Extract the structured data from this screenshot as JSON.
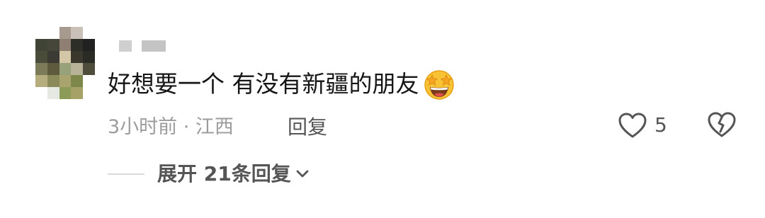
{
  "comment": {
    "text": "好想要一个 有没有新疆的朋友",
    "emoji_icon": "star-struck-emoji-icon",
    "time_location": "3小时前 · 江西",
    "reply_label": "回复",
    "like_count": "5",
    "expand_label": "展开 21条回复"
  },
  "colors": {
    "primary_text": "#161616",
    "secondary_text": "#9c9c9c",
    "action_text": "#555555",
    "icon_stroke": "#555555"
  },
  "avatar_pixels": [
    [
      "#ffffff",
      "#ffffff",
      "#a69a8e",
      "#c9c1b8",
      "#ffffff"
    ],
    [
      "#3f4436",
      "#46463a",
      "#8f7f72",
      "#2e2e28",
      "#212121"
    ],
    [
      "#4a4c3a",
      "#3c3b33",
      "#d3c7a7",
      "#3a382d",
      "#2b2b25"
    ],
    [
      "#7b7b5a",
      "#5e5a3e",
      "#97a17a",
      "#b8b398",
      "#4e4c3b"
    ],
    [
      "#b6ad7f",
      "#8b8a5a",
      "#a8a36f",
      "#7e874a",
      "#ffffff"
    ],
    [
      "#ffffff",
      "#e6e8e2",
      "#8c9c58",
      "#a6a267",
      "#ffffff"
    ]
  ]
}
